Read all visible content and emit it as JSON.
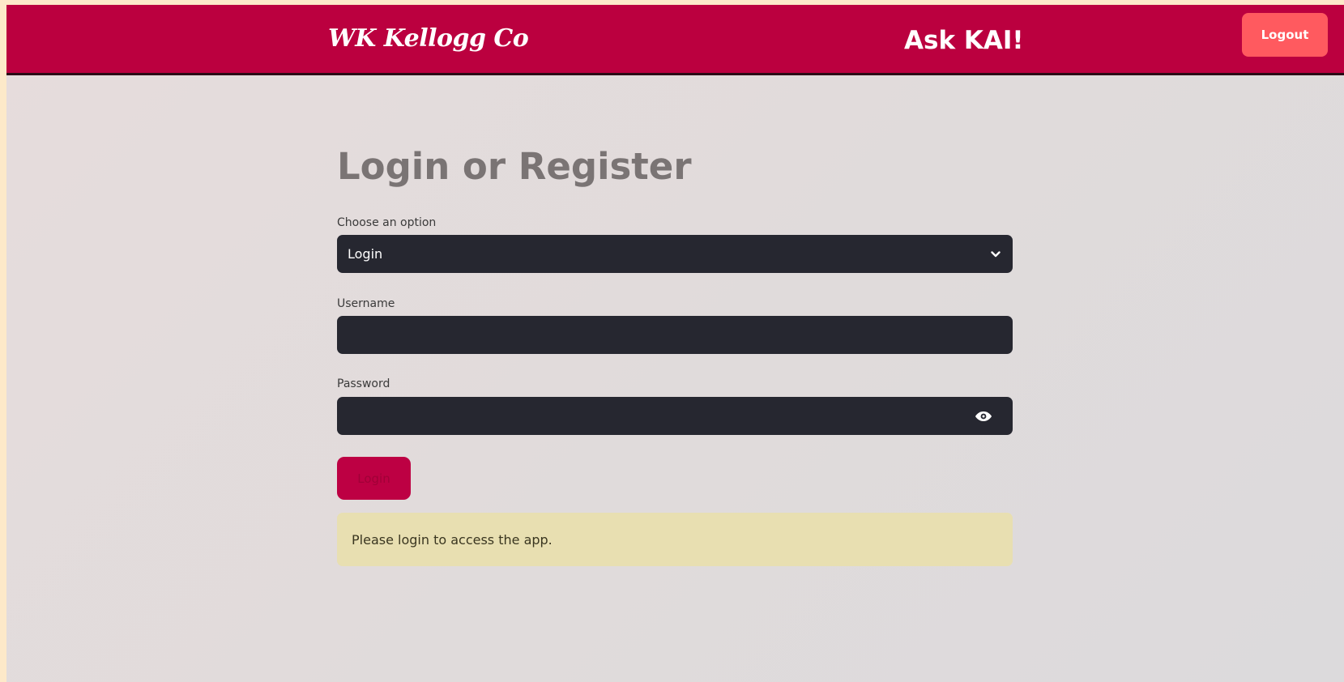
{
  "header": {
    "logo_text": "WK Kellogg Co",
    "title": "Ask KAI!",
    "logout_label": "Logout"
  },
  "main": {
    "title": "Login or Register",
    "option_label": "Choose an option",
    "option_value": "Login",
    "username_label": "Username",
    "username_value": "",
    "password_label": "Password",
    "password_value": "",
    "login_button_label": "Login",
    "alert_text": "Please login to access the app."
  },
  "colors": {
    "header_bg": "#bb003f",
    "logout_bg": "#ff5a5f",
    "input_bg": "#262730",
    "login_button_bg": "#bd0043",
    "alert_bg": "#e8dfb1"
  },
  "icons": {
    "select": "chevron-down-icon",
    "password_toggle": "eye-icon"
  }
}
